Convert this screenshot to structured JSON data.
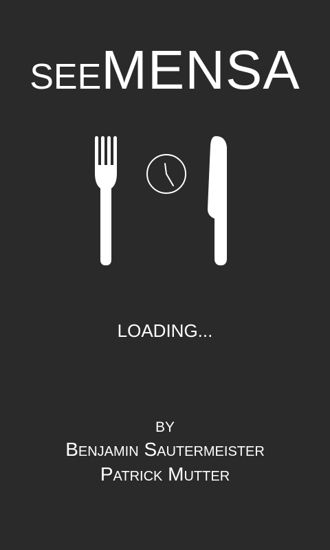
{
  "app": {
    "logo_prefix": "SEE",
    "logo_main": "MENSA"
  },
  "status": {
    "loading_text": "LOADING..."
  },
  "credits": {
    "by_label": "BY",
    "authors": [
      "Benjamin Sautermeister",
      "Patrick Mutter"
    ]
  },
  "icons": {
    "fork": "fork-icon",
    "clock": "clock-icon",
    "knife": "knife-icon"
  },
  "colors": {
    "background": "#2a2a2a",
    "foreground": "#ffffff"
  }
}
